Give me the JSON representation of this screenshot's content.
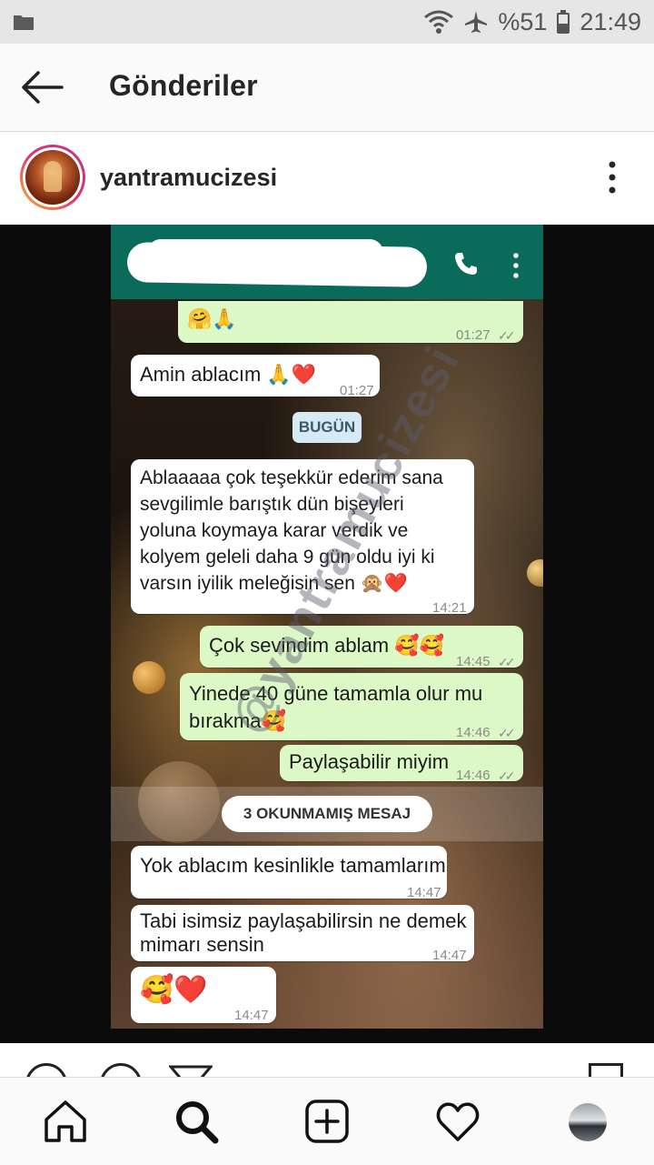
{
  "status_bar": {
    "battery": "%51",
    "time": "21:49",
    "icons": [
      "folder-icon",
      "wifi-icon",
      "airplane-icon",
      "battery-icon"
    ]
  },
  "header": {
    "title": "Gönderiler",
    "back_icon": "arrow-left-icon"
  },
  "post": {
    "username": "yantramucizesi",
    "more_icon": "vertical-dots-icon"
  },
  "chat": {
    "day_label": "BUGÜN",
    "unread_label": "3 OKUNMAMIŞ MESAJ",
    "watermark": "@yantramucizesi",
    "messages": [
      {
        "dir": "out",
        "text": "🤗🙏",
        "time": "01:27",
        "ticks": "✓✓"
      },
      {
        "dir": "in",
        "text": "Amin ablacım 🙏❤️",
        "time": "01:27"
      },
      {
        "dir": "in",
        "text": "Ablaaaaa çok teşekkür ederim sana\nsevgilimle barıştık dün bişeyleri\nyoluna koymaya karar verdik ve\nkolyem geleli daha 9 gün oldu iyi ki\nvarsın iyilik meleğisin sen 🙊❤️",
        "time": "14:21"
      },
      {
        "dir": "out",
        "text": "Çok sevindim ablam 🥰🥰",
        "time": "14:45",
        "ticks": "✓✓"
      },
      {
        "dir": "out",
        "text": "Yinede 40 güne tamamla olur mu\nbırakma🥰",
        "time": "14:46",
        "ticks": "✓✓"
      },
      {
        "dir": "out",
        "text": "Paylaşabilir miyim",
        "time": "14:46",
        "ticks": "✓✓"
      },
      {
        "dir": "in",
        "text": "Yok ablacım kesinlikle tamamlarım",
        "time": "14:47"
      },
      {
        "dir": "in",
        "text": "Tabi isimsiz paylaşabilirsin ne demek\nmimarı sensin",
        "time": "14:47"
      },
      {
        "dir": "in",
        "text": "🥰❤️",
        "time": "14:47"
      }
    ]
  },
  "bottom_nav": {
    "items": [
      "home-icon",
      "search-icon",
      "add-post-icon",
      "heart-icon",
      "profile-avatar"
    ]
  }
}
